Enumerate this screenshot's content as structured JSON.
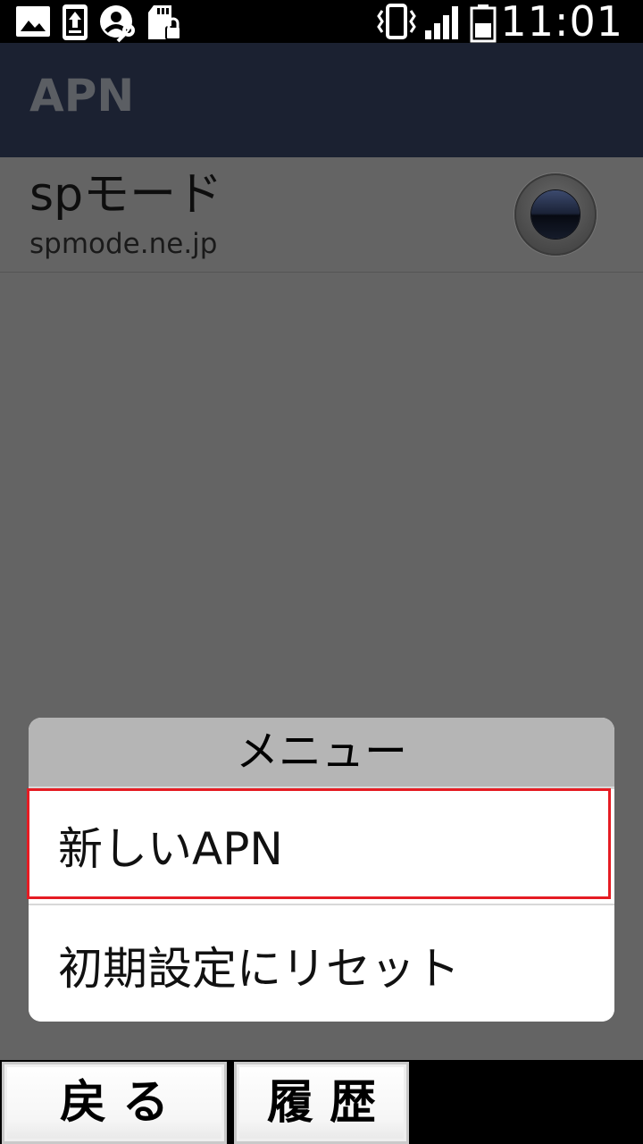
{
  "status_bar": {
    "time": "11:01",
    "icons": [
      "image-icon",
      "upload-icon",
      "user-key-icon",
      "sd-card-lock-icon",
      "vibrate-icon",
      "signal-icon",
      "battery-icon"
    ]
  },
  "action_bar": {
    "title": "APN"
  },
  "apn_list": [
    {
      "name": "spモード",
      "apn": "spmode.ne.jp",
      "selected": true
    }
  ],
  "dialog": {
    "title": "メニュー",
    "items": [
      {
        "label": "新しいAPN",
        "highlighted": true
      },
      {
        "label": "初期設定にリセット",
        "highlighted": false
      }
    ]
  },
  "bottom_bar": {
    "back_label": "戻る",
    "history_label": "履歴"
  },
  "colors": {
    "action_bar": "#1b2131",
    "dim_background": "#646464",
    "dialog_header": "#b5b5b5",
    "highlight": "#e51c23"
  }
}
